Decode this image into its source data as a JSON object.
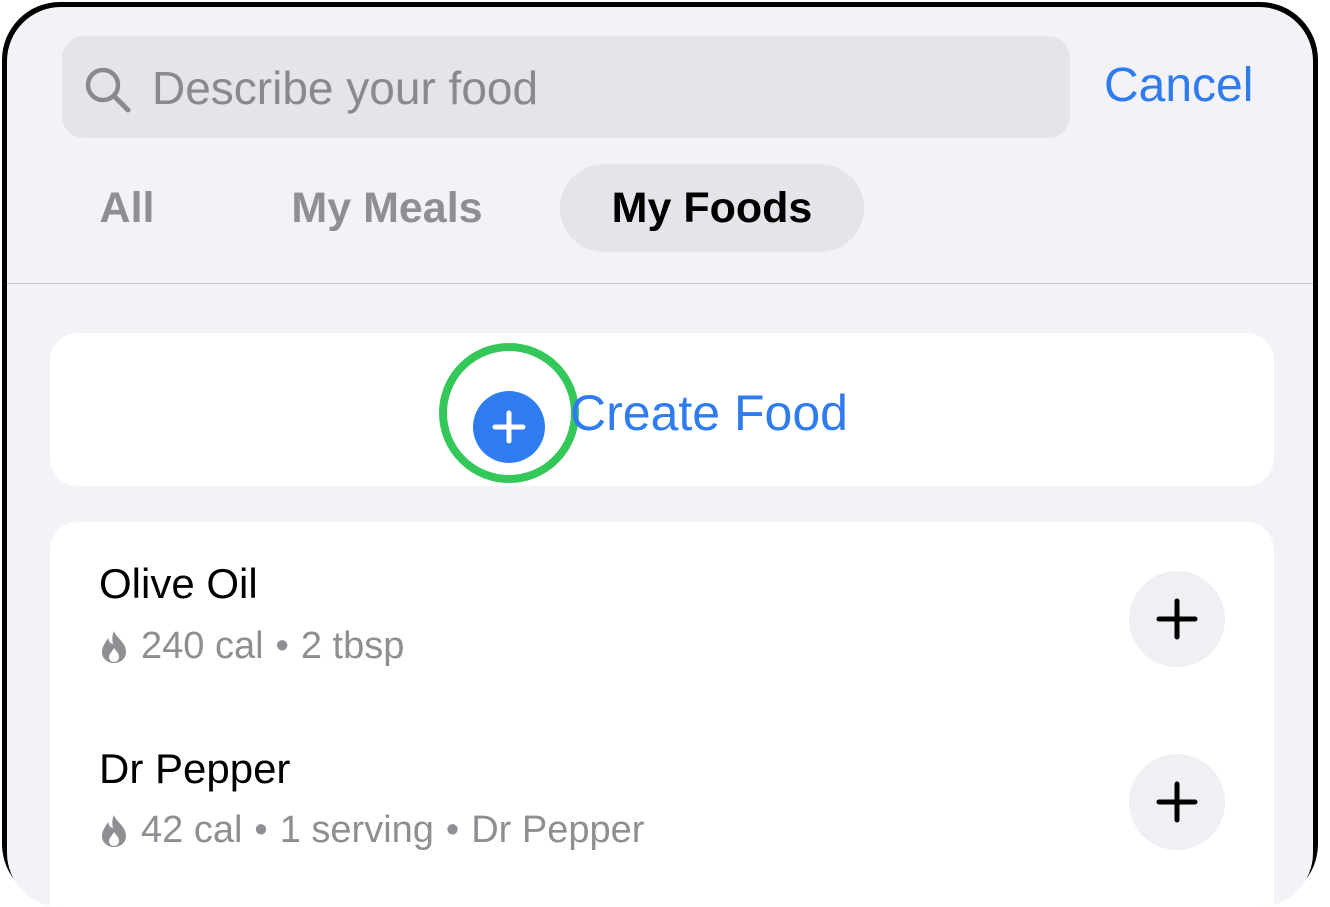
{
  "search": {
    "placeholder": "Describe your food",
    "cancel_label": "Cancel"
  },
  "tabs": [
    {
      "label": "All",
      "selected": false
    },
    {
      "label": "My Meals",
      "selected": false
    },
    {
      "label": "My Foods",
      "selected": true
    }
  ],
  "create_food": {
    "label": "Create Food"
  },
  "foods": [
    {
      "name": "Olive Oil",
      "calories": "240 cal",
      "serving": "2 tbsp"
    },
    {
      "name": "Dr Pepper",
      "calories": "42 cal",
      "serving": "1 serving",
      "brand": "Dr Pepper"
    }
  ],
  "colors": {
    "accent": "#2f7bf0",
    "highlight": "#34c759",
    "background": "#f2f2f7",
    "secondary_text": "#8e8e93"
  },
  "icons": {
    "search": "magnifying-glass-icon",
    "create": "plus-circle-icon",
    "calories": "flame-icon",
    "add": "plus-icon"
  }
}
